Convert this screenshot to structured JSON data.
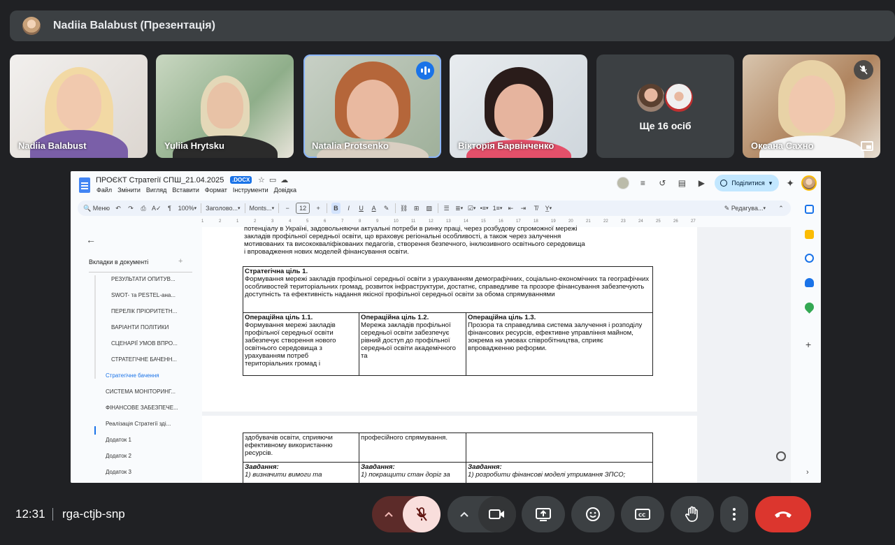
{
  "presenter": {
    "title": "Nadiia Balabust (Презентація)",
    "avatar_icon": "avatar"
  },
  "tiles": [
    {
      "name": "Nadiia Balabust"
    },
    {
      "name": "Yuliia Hrytsku"
    },
    {
      "name": "Natalia Protsenko",
      "speaking": true
    },
    {
      "name": "Вікторія Барвінченко"
    },
    {
      "more_label": "Ще 16 осіб"
    },
    {
      "name": "Оксана Сахно",
      "muted": true
    }
  ],
  "doc": {
    "title": "ПРОЄКТ Стратегії СПШ_21.04.2025",
    "badge": ".DOCX",
    "menu": [
      "Файл",
      "Змінити",
      "Вигляд",
      "Вставити",
      "Формат",
      "Інструменти",
      "Довідка"
    ],
    "share_label": "Поділитися",
    "toolbar": {
      "search": "Меню",
      "zoom": "100%",
      "style": "Заголово...",
      "font": "Monts...",
      "font_size": "12",
      "edit_mode": "Редагува..."
    },
    "ruler": [
      "1",
      "2",
      "1",
      "2",
      "3",
      "4",
      "5",
      "6",
      "7",
      "8",
      "9",
      "10",
      "11",
      "12",
      "13",
      "14",
      "15",
      "16",
      "17",
      "18",
      "19",
      "20",
      "21",
      "22",
      "23",
      "24",
      "25",
      "26",
      "27"
    ],
    "sidebar": {
      "tabs_label": "Вкладки в документі",
      "items": [
        "РЕЗУЛЬТАТИ ОПИТУВ...",
        "SWOT- та PESTEL-ана...",
        "ПЕРЕЛІК ПРІОРИТЕТН...",
        "ВАРІАНТИ ПОЛІТИКИ",
        "СЦЕНАРІЇ УМОВ ВПРО...",
        "СТРАТЕГІЧНЕ БАЧЕНН...",
        "Стратегічне бачення",
        "СИСТЕМА МОНІТОРИНГ...",
        "ФІНАНСОВЕ ЗАБЕЗПЕЧЕ...",
        "Реалізація Стратегії зді...",
        "Додаток 1",
        "Додаток 2",
        "Додаток 3"
      ]
    },
    "intro_lines": [
      "потенціалу в Україні, задовольняючи актуальні потреби в ринку праці, через розбудову спроможної мережі",
      "закладів профільної середньої освіти, що враховує регіональні особливості, а також через залучення",
      "мотивованих та висококваліфікованих педагогів, створення безпечного, інклюзивного освітнього середовища",
      "і впровадження нових моделей фінансування освіти."
    ],
    "goal_title": "Стратегічна ціль 1.",
    "goal_text": "Формування мережі закладів профільної середньої освіти з урахуванням демографічних, соціально-економічних та географічних особливостей територіальних громад, розвиток інфраструктури, достатнє, справедливе та прозоре фінансування забезпечують доступність та ефективність надання якісної профільної середньої освіти за обома спрямуваннями",
    "ops": [
      {
        "title": "Операційна ціль 1.1.",
        "text": "Формування мережі закладів профільної середньої освіти забезпечує створення нового освітнього середовища з урахуванням потреб територіальних громад і"
      },
      {
        "title": "Операційна ціль 1.2.",
        "text": "Мережа закладів профільної середньої освіти забезпечує рівний доступ до профільної середньої освіти академічного та"
      },
      {
        "title": "Операційна ціль 1.3.",
        "text": "Прозора та справедлива система залучення і розподілу фінансових ресурсів, ефективне управління майном, зокрема на умовах співробітництва, сприяє впровадженню реформи."
      }
    ],
    "page2": {
      "cont": [
        "здобувачів освіти, сприяючи ефективному використанню ресурсів.",
        "професійного спрямування.",
        ""
      ],
      "task_label": "Завдання:",
      "tasks": [
        "1) визначити вимоги та",
        "1) покращити стан доріг за",
        "1) розробити фінансові моделі утримання ЗПСО;"
      ]
    }
  },
  "bottom": {
    "time": "12:31",
    "code": "rga-ctjb-snp"
  },
  "colors": {
    "bg": "#202124",
    "tile": "#3c4043",
    "hangup": "#dc362e",
    "mic_off_bg": "#f9dedc",
    "accent": "#1a73e8"
  }
}
